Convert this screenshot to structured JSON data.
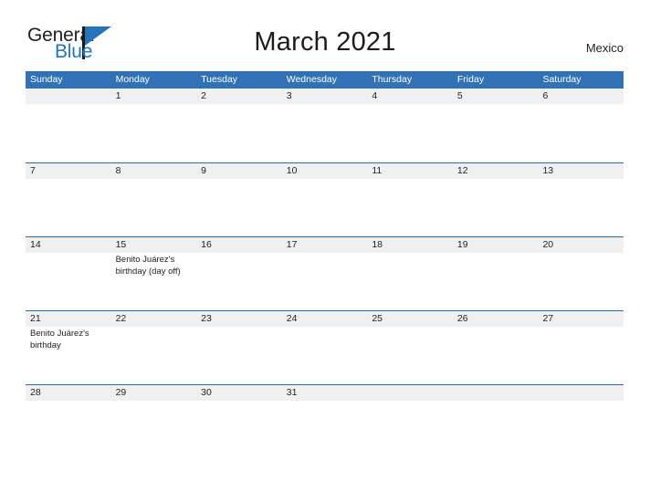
{
  "brand": {
    "name_top": "General",
    "name_bottom": "Blue",
    "accent_color": "#2573b8",
    "flag_icon": "triangle-flag-icon"
  },
  "header": {
    "title": "March 2021",
    "country": "Mexico"
  },
  "calendar": {
    "header_bg": "#3072b5",
    "row_border": "#2e6da4",
    "daynum_band_bg": "#f0f0f0",
    "weekdays": [
      "Sunday",
      "Monday",
      "Tuesday",
      "Wednesday",
      "Thursday",
      "Friday",
      "Saturday"
    ],
    "weeks": [
      [
        {
          "day": "",
          "event": ""
        },
        {
          "day": "1",
          "event": ""
        },
        {
          "day": "2",
          "event": ""
        },
        {
          "day": "3",
          "event": ""
        },
        {
          "day": "4",
          "event": ""
        },
        {
          "day": "5",
          "event": ""
        },
        {
          "day": "6",
          "event": ""
        }
      ],
      [
        {
          "day": "7",
          "event": ""
        },
        {
          "day": "8",
          "event": ""
        },
        {
          "day": "9",
          "event": ""
        },
        {
          "day": "10",
          "event": ""
        },
        {
          "day": "11",
          "event": ""
        },
        {
          "day": "12",
          "event": ""
        },
        {
          "day": "13",
          "event": ""
        }
      ],
      [
        {
          "day": "14",
          "event": ""
        },
        {
          "day": "15",
          "event": "Benito Juárez's birthday (day off)"
        },
        {
          "day": "16",
          "event": ""
        },
        {
          "day": "17",
          "event": ""
        },
        {
          "day": "18",
          "event": ""
        },
        {
          "day": "19",
          "event": ""
        },
        {
          "day": "20",
          "event": ""
        }
      ],
      [
        {
          "day": "21",
          "event": "Benito Juárez's birthday"
        },
        {
          "day": "22",
          "event": ""
        },
        {
          "day": "23",
          "event": ""
        },
        {
          "day": "24",
          "event": ""
        },
        {
          "day": "25",
          "event": ""
        },
        {
          "day": "26",
          "event": ""
        },
        {
          "day": "27",
          "event": ""
        }
      ],
      [
        {
          "day": "28",
          "event": ""
        },
        {
          "day": "29",
          "event": ""
        },
        {
          "day": "30",
          "event": ""
        },
        {
          "day": "31",
          "event": ""
        },
        {
          "day": "",
          "event": ""
        },
        {
          "day": "",
          "event": ""
        },
        {
          "day": "",
          "event": ""
        }
      ]
    ]
  }
}
